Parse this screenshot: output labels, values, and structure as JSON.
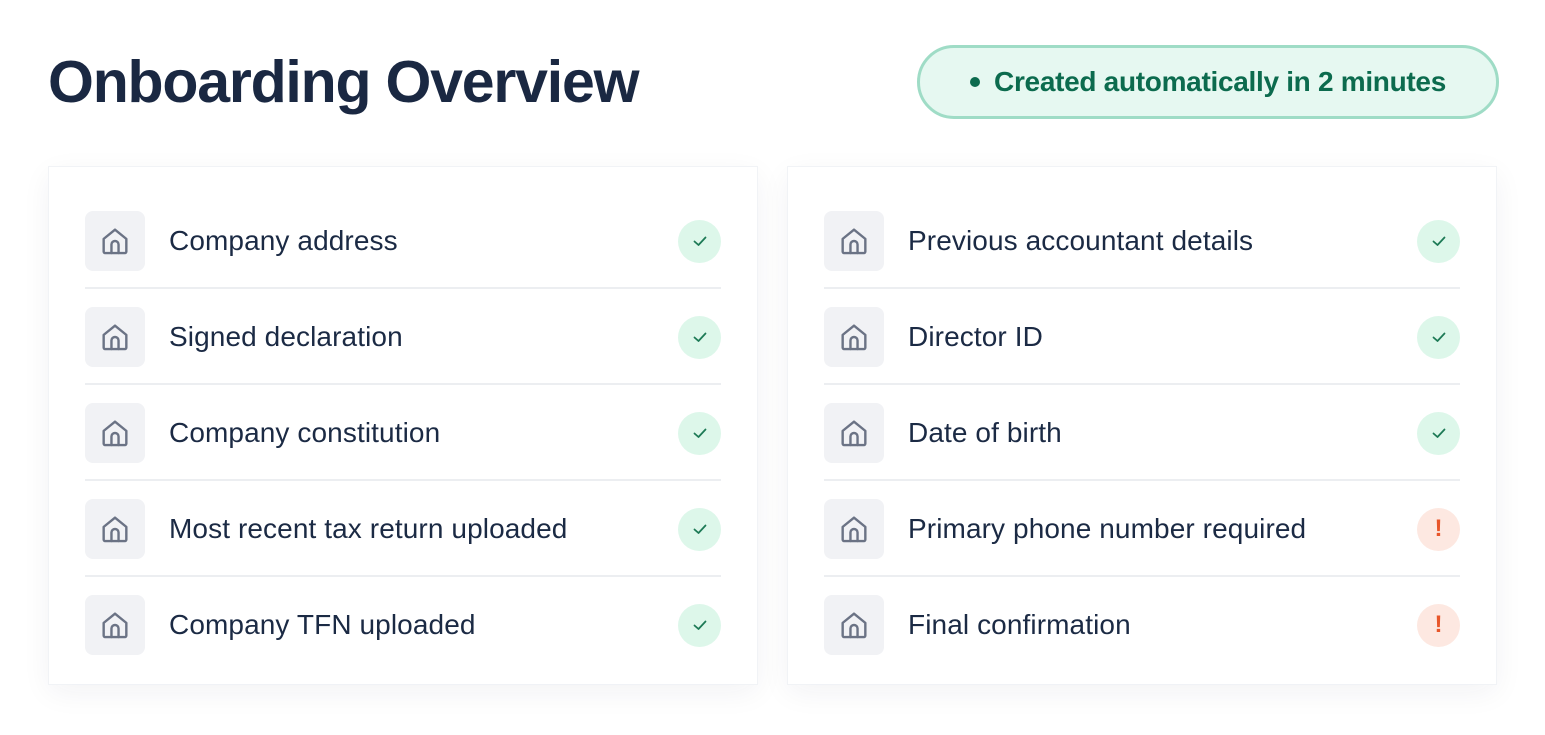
{
  "header": {
    "title": "Onboarding Overview",
    "badge_text": "Created automatically in 2 minutes"
  },
  "colors": {
    "title": "#1a2842",
    "badge_bg": "#e6f8f1",
    "badge_border": "#9fdcc6",
    "badge_text": "#0c6b4e",
    "ok_bg": "#ddf7ea",
    "ok_check": "#1d7a56",
    "warn_bg": "#fde8e1",
    "warn_mark": "#e8562a",
    "icon_bg": "#f1f2f5",
    "icon_stroke": "#6b7385"
  },
  "left_column": {
    "items": [
      {
        "label": "Company address",
        "icon": "house-icon",
        "status": "complete"
      },
      {
        "label": "Signed declaration",
        "icon": "house-icon",
        "status": "complete"
      },
      {
        "label": "Company constitution",
        "icon": "house-icon",
        "status": "complete"
      },
      {
        "label": "Most recent tax return uploaded",
        "icon": "house-icon",
        "status": "complete"
      },
      {
        "label": "Company TFN uploaded",
        "icon": "house-icon",
        "status": "complete"
      }
    ]
  },
  "right_column": {
    "items": [
      {
        "label": "Previous accountant details",
        "icon": "house-icon",
        "status": "complete"
      },
      {
        "label": "Director ID",
        "icon": "house-icon",
        "status": "complete"
      },
      {
        "label": "Date of birth",
        "icon": "house-icon",
        "status": "complete"
      },
      {
        "label": "Primary phone number required",
        "icon": "house-icon",
        "status": "attention"
      },
      {
        "label": "Final confirmation",
        "icon": "house-icon",
        "status": "attention"
      }
    ]
  },
  "status_marks": {
    "attention": "!"
  }
}
